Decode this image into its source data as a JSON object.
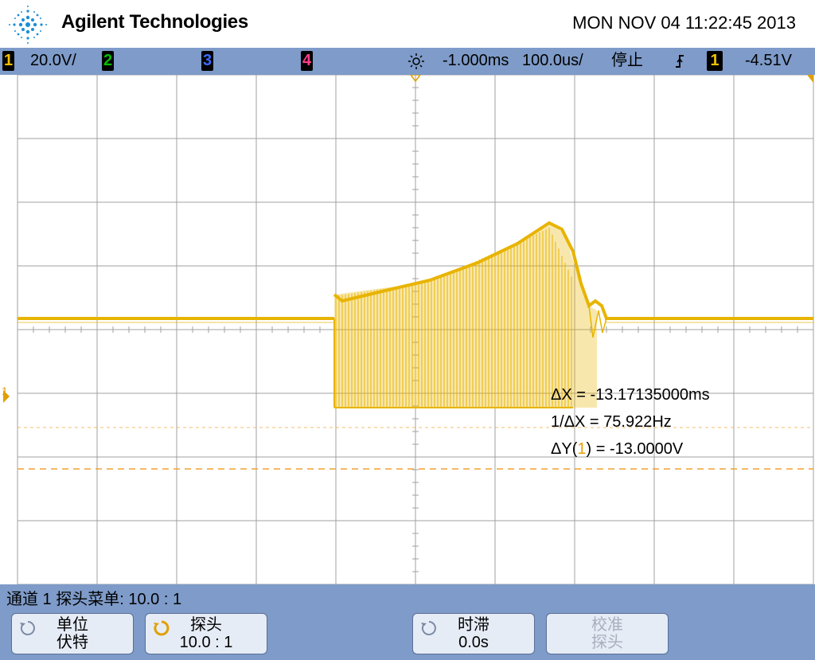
{
  "header": {
    "brand": "Agilent Technologies",
    "datetime": "MON NOV 04 11:22:45 2013"
  },
  "status": {
    "ch1": {
      "num": "1",
      "scale": "20.0V/",
      "color": "#f0c000"
    },
    "ch2": {
      "num": "2",
      "color": "#00c000"
    },
    "ch3": {
      "num": "3",
      "color": "#3d6bff"
    },
    "ch4": {
      "num": "4",
      "color": "#ff3d8b"
    },
    "delay": "-1.000ms",
    "timebase": "100.0us/",
    "run_state": "停止",
    "trigger_source": "1",
    "trigger_level": "-4.51V"
  },
  "measurements": {
    "dx": "ΔX = -13.17135000ms",
    "inv_dx": "1/ΔX = 75.922Hz",
    "dy_prefix": "ΔY(",
    "dy_channel": "1",
    "dy_suffix": ") = -13.0000V"
  },
  "softkeys": {
    "menu_title": "通道 1  探头菜单: 10.0 : 1",
    "unit": {
      "line1": "单位",
      "line2": "伏特"
    },
    "probe": {
      "line1": "探头",
      "line2": "10.0 : 1"
    },
    "skew": {
      "line1": "时滞",
      "line2": "0.0s"
    },
    "calibrate": {
      "line1": "校准",
      "line2": "探头"
    }
  },
  "colors": {
    "trace": "#e8b400",
    "cursor": "#f0a030",
    "grid": "#a0a0a0",
    "status_bar": "#7e9bc9"
  },
  "icons": {
    "logo": "agilent-spark-logo",
    "delay": "delay-sun-icon",
    "trigger": "trigger-edge-icon",
    "knob": "entry-knob-icon"
  }
}
